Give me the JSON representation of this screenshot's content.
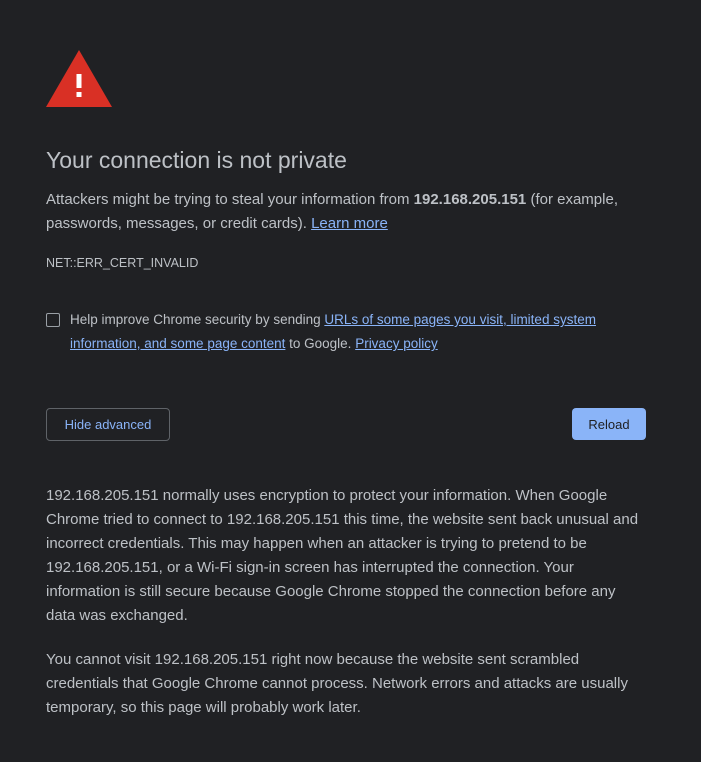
{
  "icon": {
    "name": "warning-triangle-icon",
    "color": "#d93025"
  },
  "heading": "Your connection is not private",
  "main_message": {
    "prefix": "Attackers might be trying to steal your information from ",
    "host": "192.168.205.151",
    "suffix": " (for example, passwords, messages, or credit cards). ",
    "learn_more": "Learn more"
  },
  "error_code": "NET::ERR_CERT_INVALID",
  "opt_in": {
    "checked": false,
    "prefix": "Help improve Chrome security by sending ",
    "link1": "URLs of some pages you visit, limited system information, and some page content",
    "middle": " to Google. ",
    "link2": "Privacy policy"
  },
  "buttons": {
    "advanced": "Hide advanced",
    "reload": "Reload"
  },
  "details": {
    "paragraph1": "192.168.205.151 normally uses encryption to protect your information. When Google Chrome tried to connect to 192.168.205.151 this time, the website sent back unusual and incorrect credentials. This may happen when an attacker is trying to pretend to be 192.168.205.151, or a Wi-Fi sign-in screen has interrupted the connection. Your information is still secure because Google Chrome stopped the connection before any data was exchanged.",
    "paragraph2": "You cannot visit 192.168.205.151 right now because the website sent scrambled credentials that Google Chrome cannot process. Network errors and attacks are usually temporary, so this page will probably work later."
  },
  "colors": {
    "background": "#202124",
    "text": "#bdc1c6",
    "link": "#8ab4f8",
    "primary_button": "#8ab4f8",
    "warning": "#d93025"
  }
}
